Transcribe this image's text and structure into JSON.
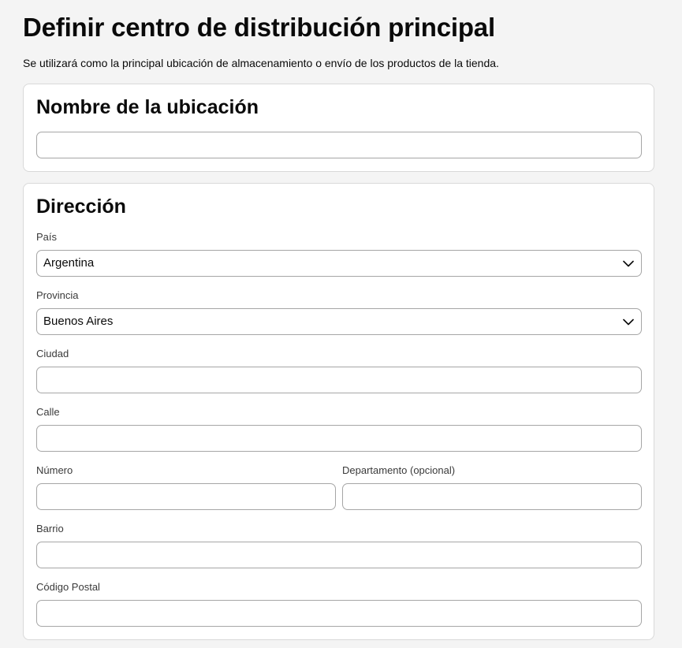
{
  "header": {
    "title": "Definir centro de distribución principal",
    "subtitle": "Se utilizará como la principal ubicación de almacenamiento o envío de los productos de la tienda."
  },
  "location_card": {
    "title": "Nombre de la ubicación",
    "name_value": "",
    "name_placeholder": ""
  },
  "address_card": {
    "title": "Dirección",
    "country": {
      "label": "País",
      "value": "Argentina"
    },
    "province": {
      "label": "Provincia",
      "value": "Buenos Aires"
    },
    "city": {
      "label": "Ciudad",
      "value": ""
    },
    "street": {
      "label": "Calle",
      "value": ""
    },
    "number": {
      "label": "Número",
      "value": ""
    },
    "apartment": {
      "label": "Departamento (opcional)",
      "value": ""
    },
    "neighborhood": {
      "label": "Barrio",
      "value": ""
    },
    "postal_code": {
      "label": "Código Postal",
      "value": ""
    }
  },
  "icons": {
    "select_arrow": "chevron-down-icon"
  },
  "colors": {
    "page_background": "#f4f4f4",
    "card_background": "#ffffff",
    "input_border": "#a6a6a6",
    "card_border": "#d9d9d9",
    "text_primary": "#0a0a0a",
    "text_label": "#3a3a3a"
  }
}
